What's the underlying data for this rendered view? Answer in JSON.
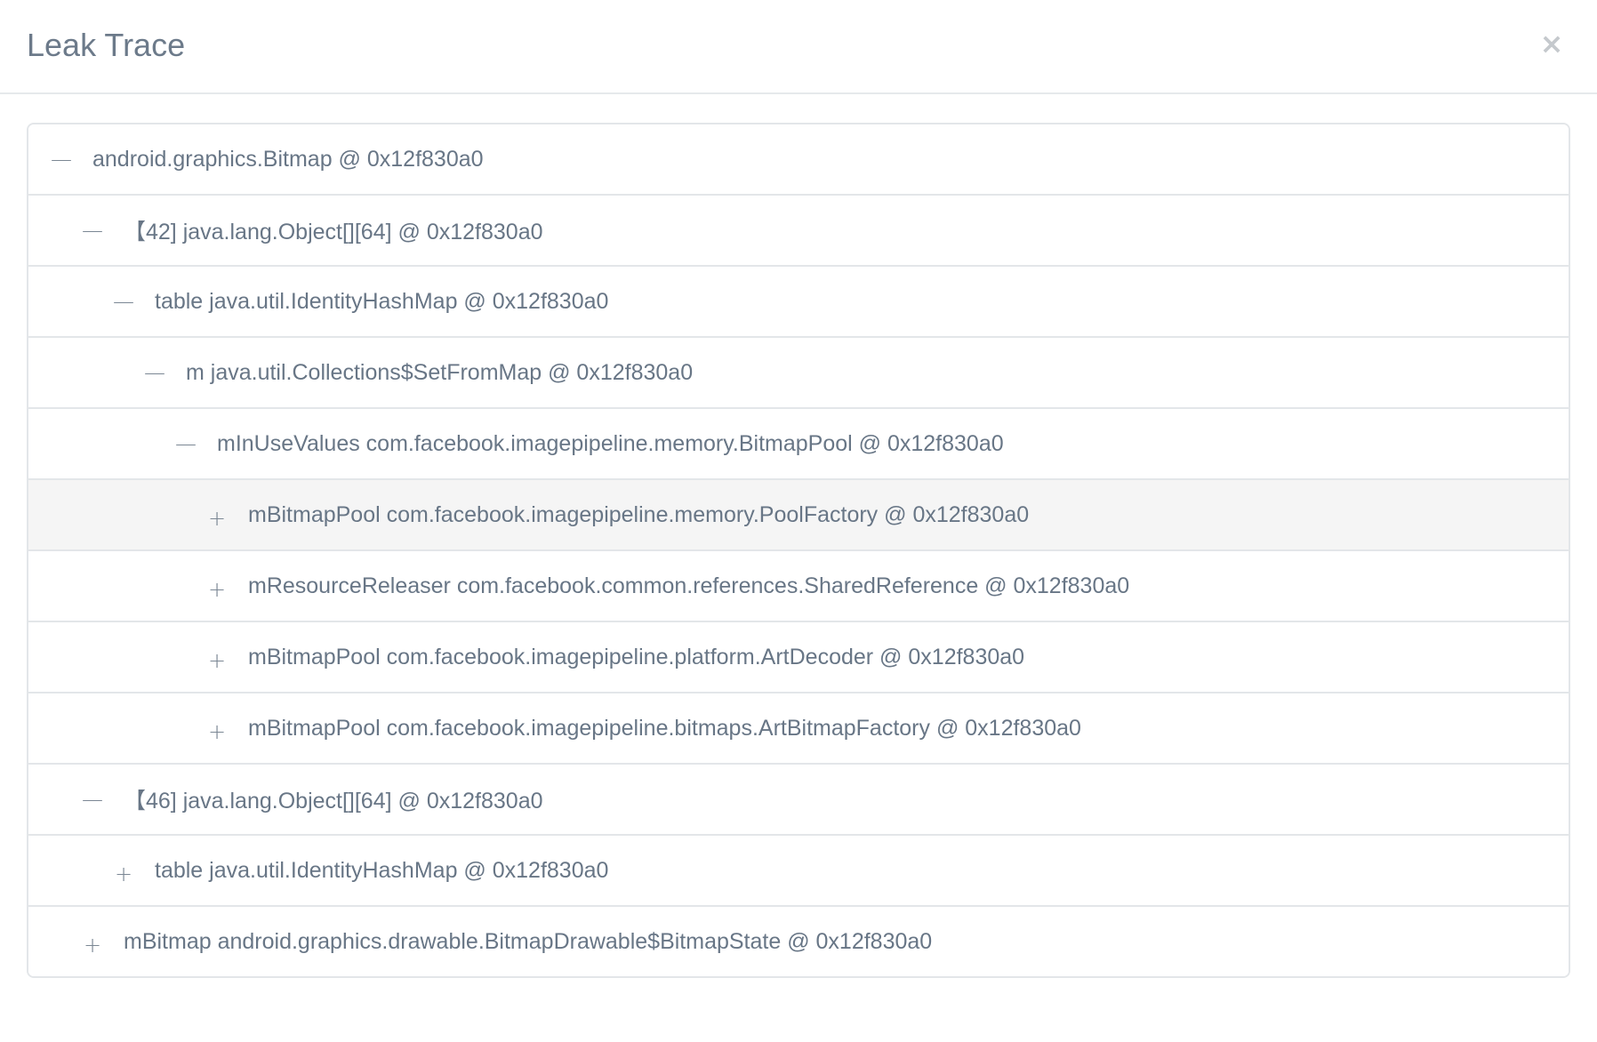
{
  "dialog": {
    "title": "Leak Trace",
    "close_symbol": "×"
  },
  "tree": {
    "rows": [
      {
        "depth": 0,
        "toggle": "—",
        "state": "expanded",
        "label": "android.graphics.Bitmap @ 0x12f830a0"
      },
      {
        "depth": 1,
        "toggle": "—",
        "state": "expanded",
        "label": "【42] java.lang.Object[][64] @ 0x12f830a0"
      },
      {
        "depth": 2,
        "toggle": "—",
        "state": "expanded",
        "label": "table java.util.IdentityHashMap @ 0x12f830a0"
      },
      {
        "depth": 3,
        "toggle": "—",
        "state": "expanded",
        "label": "m java.util.Collections$SetFromMap @ 0x12f830a0"
      },
      {
        "depth": 4,
        "toggle": "—",
        "state": "expanded",
        "label": "mInUseValues com.facebook.imagepipeline.memory.BitmapPool @ 0x12f830a0"
      },
      {
        "depth": 5,
        "toggle": "+",
        "state": "collapsed",
        "highlighted": true,
        "label": "mBitmapPool com.facebook.imagepipeline.memory.PoolFactory @ 0x12f830a0"
      },
      {
        "depth": 5,
        "toggle": "+",
        "state": "collapsed",
        "label": "mResourceReleaser com.facebook.common.references.SharedReference @ 0x12f830a0"
      },
      {
        "depth": 5,
        "toggle": "+",
        "state": "collapsed",
        "label": "mBitmapPool com.facebook.imagepipeline.platform.ArtDecoder @ 0x12f830a0"
      },
      {
        "depth": 5,
        "toggle": "+",
        "state": "collapsed",
        "label": "mBitmapPool com.facebook.imagepipeline.bitmaps.ArtBitmapFactory @ 0x12f830a0"
      },
      {
        "depth": 1,
        "toggle": "—",
        "state": "expanded",
        "label": "【46] java.lang.Object[][64] @ 0x12f830a0"
      },
      {
        "depth": 2,
        "toggle": "+",
        "state": "collapsed",
        "label": "table java.util.IdentityHashMap @ 0x12f830a0"
      },
      {
        "depth": 1,
        "toggle": "+",
        "state": "collapsed",
        "label": "mBitmap android.graphics.drawable.BitmapDrawable$BitmapState @ 0x12f830a0"
      }
    ]
  },
  "colors": {
    "title": "#6c7a8a",
    "text": "#687686",
    "border": "#e3e6e9",
    "highlight": "#f5f5f5"
  }
}
